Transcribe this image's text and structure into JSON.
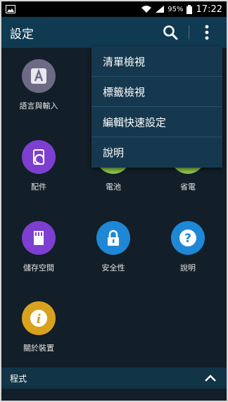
{
  "status_bar": {
    "battery_percent": "95%",
    "time": "17:22"
  },
  "action_bar": {
    "title": "設定"
  },
  "grid": {
    "items": [
      {
        "label": "語言與輸入",
        "color": "#6d6a85",
        "icon": "language-icon"
      },
      {
        "label": "配件",
        "color": "#7d3fd0",
        "icon": "accessory-icon"
      },
      {
        "label": "電池",
        "color": "#8bc34a",
        "icon": "battery-icon"
      },
      {
        "label": "省電",
        "color": "#8bc34a",
        "icon": "power-saving-icon"
      },
      {
        "label": "儲存空間",
        "color": "#7d3fd0",
        "icon": "sd-card-icon"
      },
      {
        "label": "安全性",
        "color": "#1e88d6",
        "icon": "lock-icon"
      },
      {
        "label": "說明",
        "color": "#1e88d6",
        "icon": "help-icon"
      },
      {
        "label": "關於裝置",
        "color": "#d9a21e",
        "icon": "info-icon"
      }
    ]
  },
  "section": {
    "label": "程式"
  },
  "menu": {
    "items": [
      {
        "label": "清單檢視"
      },
      {
        "label": "標籤檢視"
      },
      {
        "label": "編輯快速設定"
      },
      {
        "label": "說明"
      }
    ]
  }
}
